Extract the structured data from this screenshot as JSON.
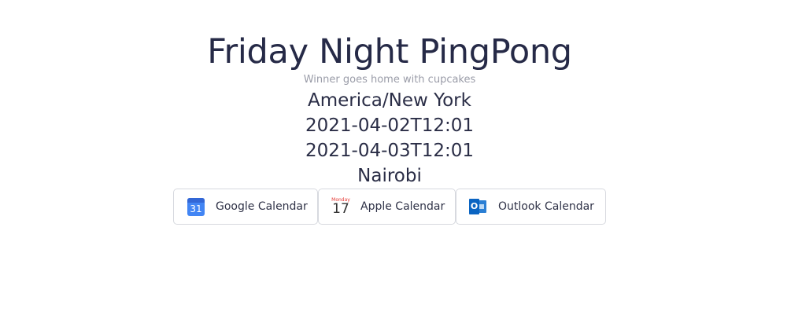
{
  "event": {
    "title": "Friday Night PingPong",
    "description": "Winner goes home with cupcakes",
    "timezone": "America/New York",
    "start": "2021-04-02T12:01",
    "end": "2021-04-03T12:01",
    "location": "Nairobi"
  },
  "buttons": {
    "google": {
      "label": "Google Calendar",
      "icon": "google-calendar-icon",
      "icon_text": "31",
      "color": "#4285f4"
    },
    "apple": {
      "label": "Apple Calendar",
      "icon": "apple-calendar-icon",
      "month_text": "Monday",
      "day_text": "17"
    },
    "outlook": {
      "label": "Outlook Calendar",
      "icon": "outlook-calendar-icon",
      "icon_text": "O",
      "color": "#0a64c2"
    }
  },
  "colors": {
    "text": "#262a47",
    "muted": "#9a9ca8",
    "border": "#d7d9df"
  }
}
